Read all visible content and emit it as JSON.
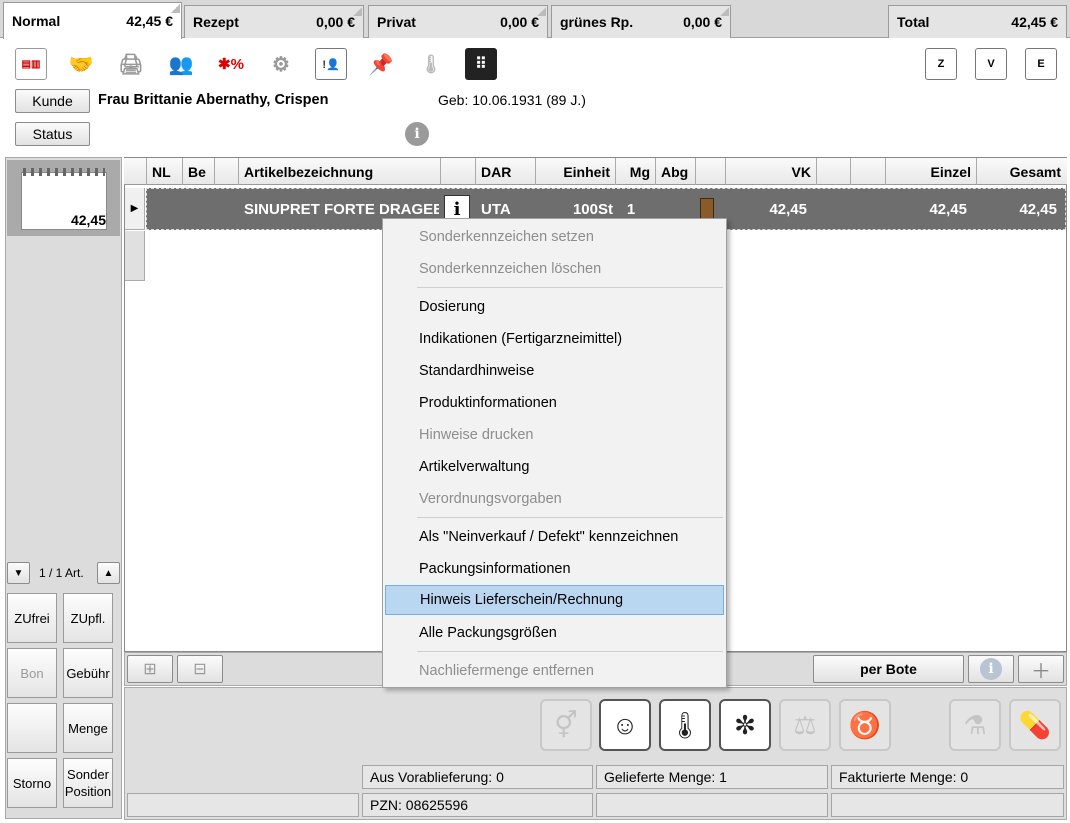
{
  "tabs": [
    {
      "label": "Normal",
      "amount": "42,45 €"
    },
    {
      "label": "Rezept",
      "amount": "0,00 €"
    },
    {
      "label": "Privat",
      "amount": "0,00 €"
    },
    {
      "label": "grünes Rp.",
      "amount": "0,00 €"
    }
  ],
  "total": {
    "label": "Total",
    "amount": "42,45 €"
  },
  "toolbar_icons_right": [
    "Z",
    "V",
    "E"
  ],
  "customer": {
    "button": "Kunde",
    "name": "Frau Brittanie Abernathy, Crispen",
    "birth": "Geb: 10.06.1931 (89 J.)",
    "status_button": "Status"
  },
  "notepad_value": "42,45",
  "grid": {
    "headers": [
      "NL",
      "Be",
      "Artikelbezeichnung",
      "DAR",
      "Einheit",
      "Mg",
      "Abg",
      "VK",
      "Einzel",
      "Gesamt"
    ],
    "row": {
      "name": "SINUPRET FORTE DRAGEES",
      "dar": "UTA",
      "einheit": "100St",
      "mg": "1",
      "vk": "42,45",
      "einzel": "42,45",
      "gesamt": "42,45"
    }
  },
  "left": {
    "article_counter": "1 / 1 Art.",
    "buttons": [
      {
        "label": "ZUfrei",
        "disabled": false
      },
      {
        "label": "ZUpfl.",
        "disabled": false
      },
      {
        "label": "Bon",
        "disabled": true
      },
      {
        "label": "Gebühr",
        "disabled": false
      },
      {
        "label": "",
        "disabled": false
      },
      {
        "label": "Menge",
        "disabled": false
      },
      {
        "label": "Storno",
        "disabled": false
      },
      {
        "label": "Sonder Position",
        "disabled": false
      }
    ]
  },
  "bottom": {
    "per_bote": "per Bote",
    "aus_vorablieferung": "Aus Vorablieferung:  0",
    "gelieferte_menge": "Gelieferte Menge:    1",
    "fakturierte_menge": "Fakturierte Menge:    0",
    "pzn": "PZN: 08625596"
  },
  "context_menu": {
    "items": [
      {
        "label": "Sonderkennzeichen setzen",
        "disabled": true
      },
      {
        "label": "Sonderkennzeichen löschen",
        "disabled": true
      },
      {
        "label": "Dosierung",
        "disabled": false
      },
      {
        "label": "Indikationen (Fertigarzneimittel)",
        "disabled": false
      },
      {
        "label": "Standardhinweise",
        "disabled": false
      },
      {
        "label": "Produktinformationen",
        "disabled": false
      },
      {
        "label": "Hinweise drucken",
        "disabled": true
      },
      {
        "label": "Artikelverwaltung",
        "disabled": false
      },
      {
        "label": "Verordnungsvorgaben",
        "disabled": true
      },
      {
        "label": "Als \"Neinverkauf / Defekt\" kennzeichnen",
        "disabled": false
      },
      {
        "label": "Packungsinformationen",
        "disabled": false
      },
      {
        "label": "Hinweis Lieferschein/Rechnung",
        "disabled": false,
        "highlighted": true
      },
      {
        "label": "Alle Packungsgrößen",
        "disabled": false
      },
      {
        "label": "Nachliefermenge entfernen",
        "disabled": true
      }
    ]
  },
  "colors": {
    "selected_row": "#6e6e6e",
    "menu_highlight": "#b9d7f1",
    "disabled_text": "#8d8d8d"
  }
}
